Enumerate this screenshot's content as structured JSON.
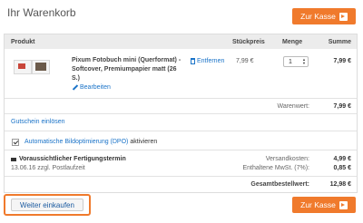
{
  "page": {
    "title": "Ihr Warenkorb"
  },
  "checkout_button": {
    "label": "Zur Kasse"
  },
  "table": {
    "headers": {
      "product": "Produkt",
      "unit_price": "Stückpreis",
      "quantity": "Menge",
      "total": "Summe"
    }
  },
  "item": {
    "name": "Pixum Fotobuch mini (Querformat) - Softcover, Premiumpapier matt (26 S.)",
    "edit_label": "Bearbeiten",
    "remove_label": "Entfernen",
    "unit_price": "7,99 €",
    "quantity": "1",
    "sum": "7,99 €"
  },
  "totals": {
    "goods_value_label": "Warenwert:",
    "goods_value": "7,99 €",
    "shipping_label": "Versandkosten:",
    "shipping": "4,99 €",
    "vat_label": "Enthaltene MwSt. (7%):",
    "vat": "0,85 €",
    "grand_total_label": "Gesamtbestellwert:",
    "grand_total": "12,98 €"
  },
  "voucher": {
    "label": "Gutschein einlösen"
  },
  "optimization": {
    "checked": true,
    "link_label": "Automatische Bildoptimierung (DPO)",
    "suffix": "aktivieren"
  },
  "delivery": {
    "title": "Voraussichtlicher Fertigungstermin",
    "text": "13.06.16 zzgl. Postlaufzeit"
  },
  "continue_button": {
    "label": "Weiter einkaufen"
  },
  "colors": {
    "accent": "#f07a2c",
    "link": "#1a73c8"
  }
}
